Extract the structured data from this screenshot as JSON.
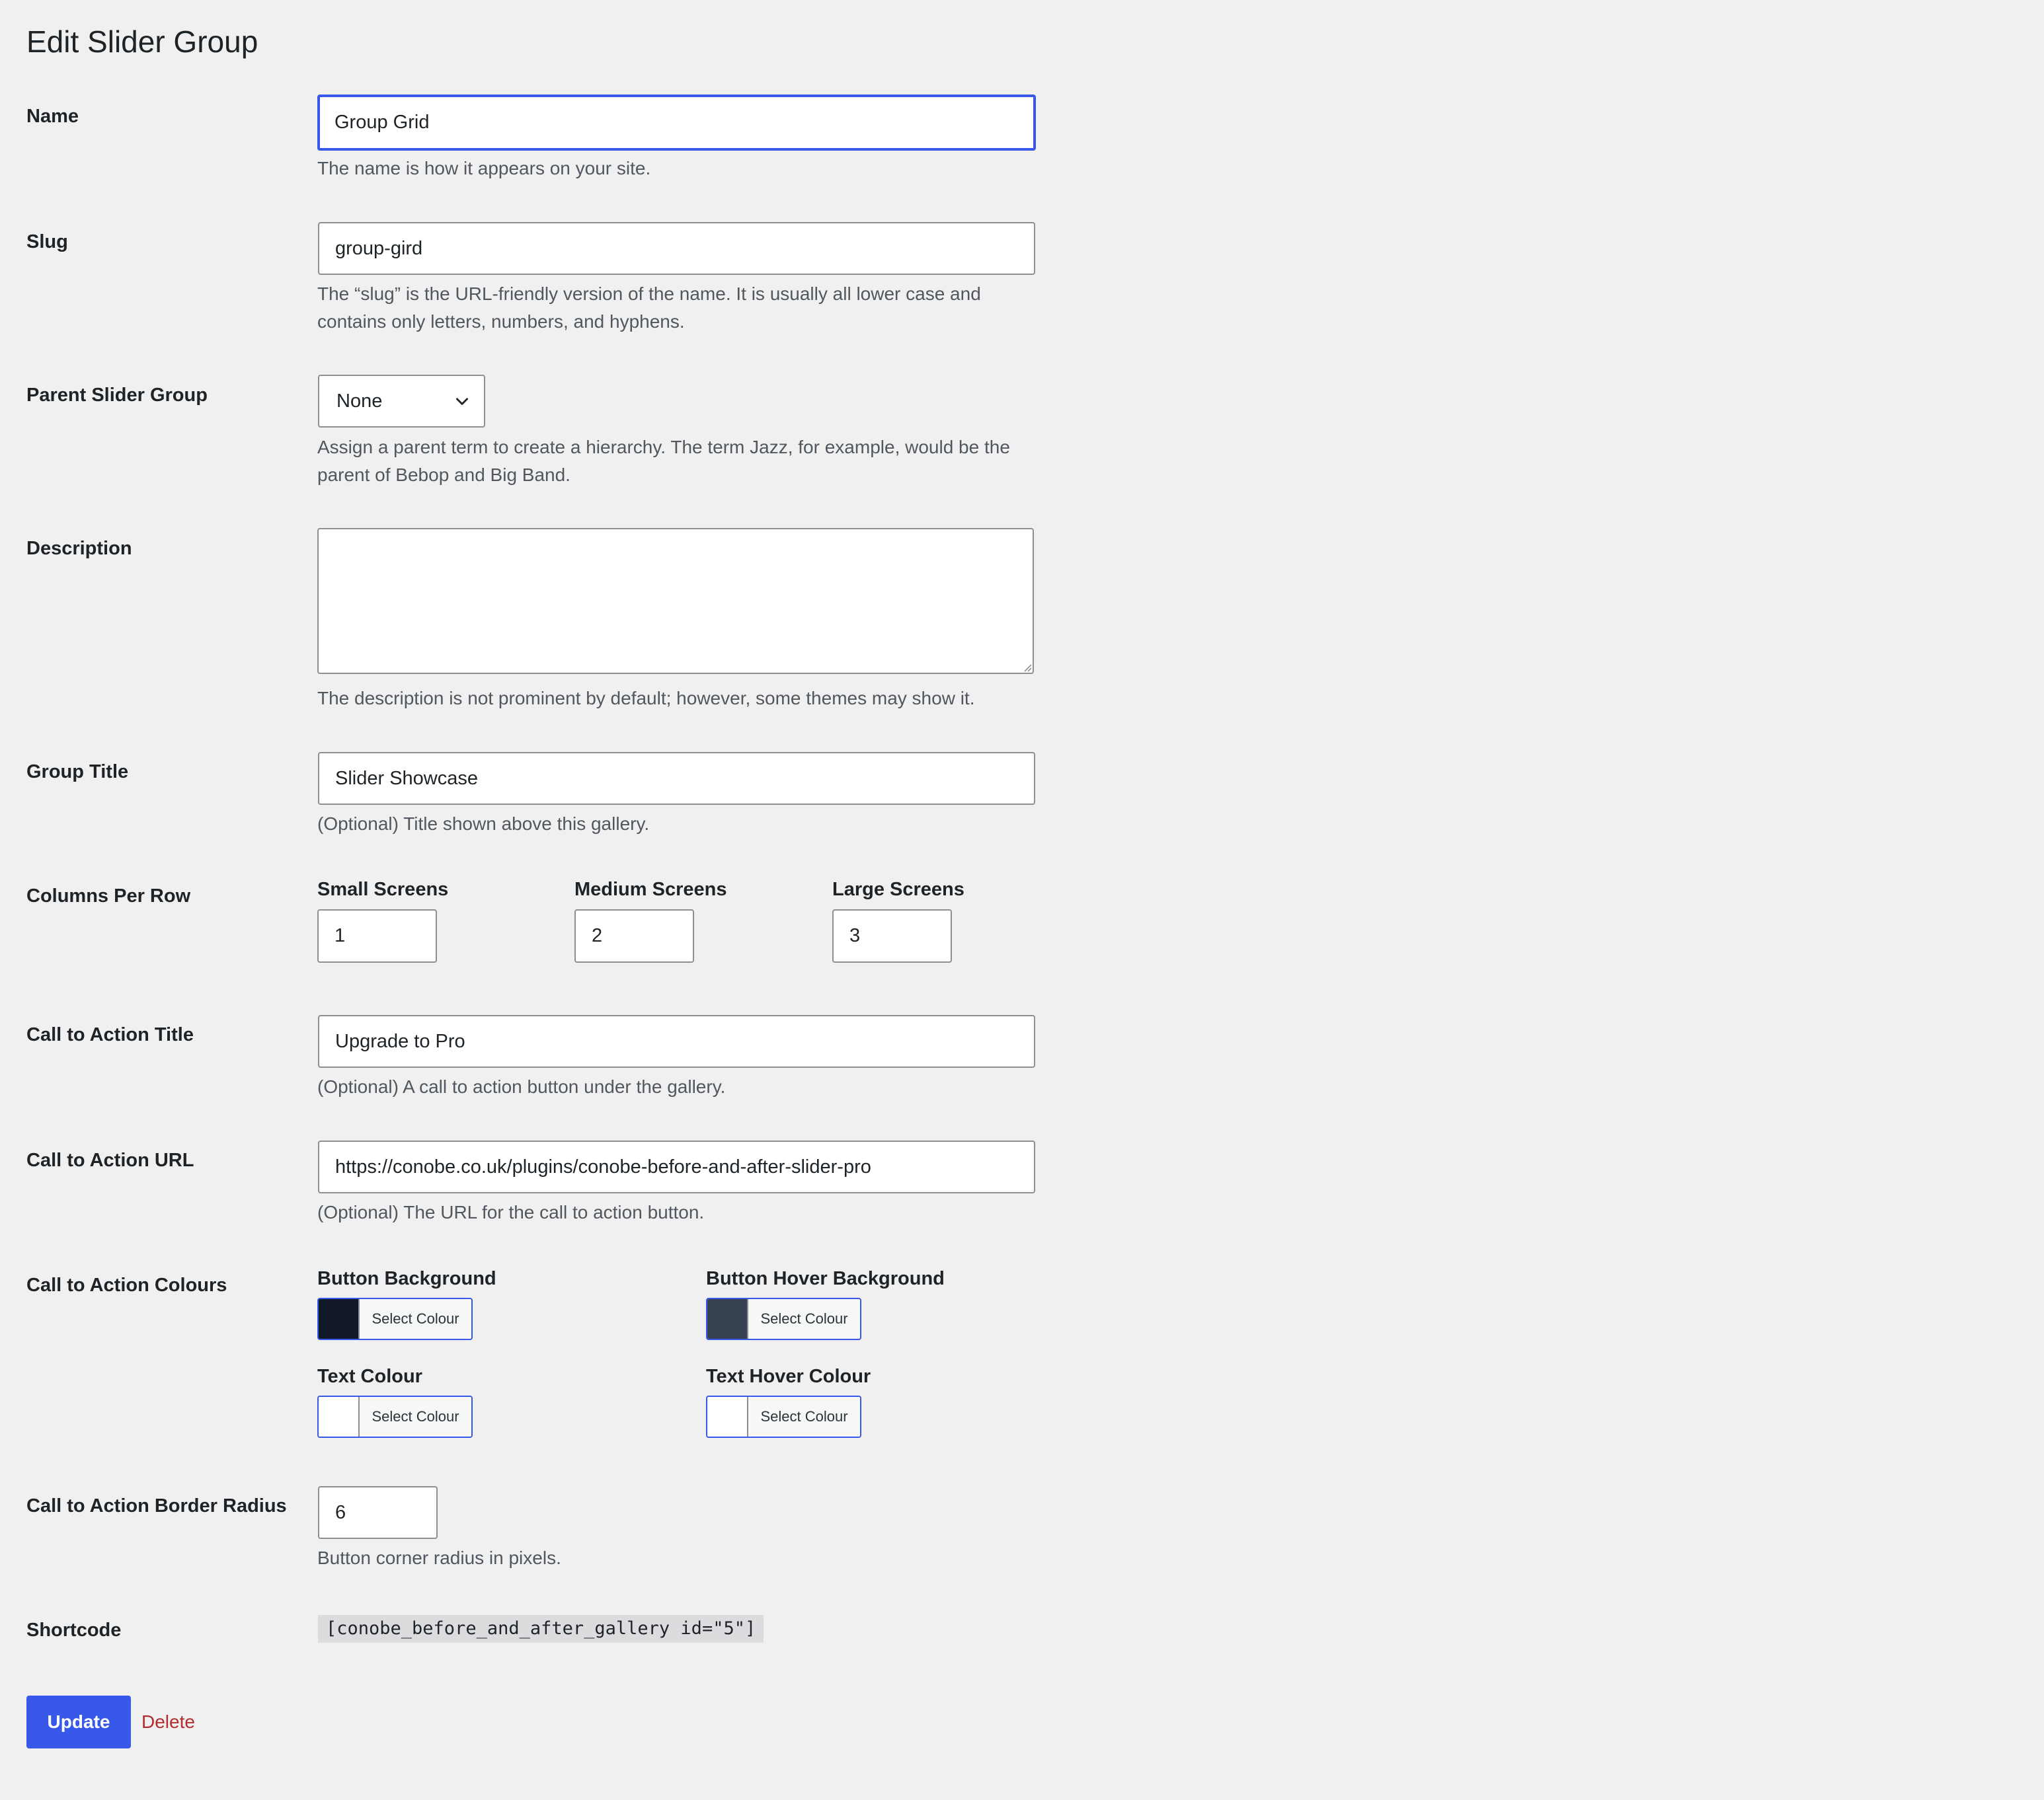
{
  "page": {
    "title": "Edit Slider Group"
  },
  "name": {
    "label": "Name",
    "value": "Group Grid",
    "description": "The name is how it appears on your site."
  },
  "slug": {
    "label": "Slug",
    "value": "group-gird",
    "description": "The “slug” is the URL-friendly version of the name. It is usually all lower case and contains only letters, numbers, and hyphens."
  },
  "parent": {
    "label": "Parent Slider Group",
    "selected": "None",
    "description": "Assign a parent term to create a hierarchy. The term Jazz, for example, would be the parent of Bebop and Big Band."
  },
  "description_field": {
    "label": "Description",
    "value": "",
    "description": "The description is not prominent by default; however, some themes may show it."
  },
  "group_title": {
    "label": "Group Title",
    "value": "Slider Showcase",
    "description": "(Optional) Title shown above this gallery."
  },
  "columns": {
    "label": "Columns Per Row",
    "small": {
      "label": "Small Screens",
      "value": "1"
    },
    "medium": {
      "label": "Medium Screens",
      "value": "2"
    },
    "large": {
      "label": "Large Screens",
      "value": "3"
    }
  },
  "cta_title": {
    "label": "Call to Action Title",
    "value": "Upgrade to Pro",
    "description": "(Optional) A call to action button under the gallery."
  },
  "cta_url": {
    "label": "Call to Action URL",
    "value": "https://conobe.co.uk/plugins/conobe-before-and-after-slider-pro",
    "description": "(Optional) The URL for the call to action button."
  },
  "cta_colours": {
    "label": "Call to Action Colours",
    "button_bg": {
      "label": "Button Background",
      "button": "Select Colour",
      "color": "#111827"
    },
    "button_hover_bg": {
      "label": "Button Hover Background",
      "button": "Select Colour",
      "color": "#374151"
    },
    "text": {
      "label": "Text Colour",
      "button": "Select Colour",
      "color": "#ffffff"
    },
    "text_hover": {
      "label": "Text Hover Colour",
      "button": "Select Colour",
      "color": "#ffffff"
    }
  },
  "cta_radius": {
    "label": "Call to Action Border Radius",
    "value": "6",
    "description": "Button corner radius in pixels."
  },
  "shortcode": {
    "label": "Shortcode",
    "value": "[conobe_before_and_after_gallery id=\"5\"]"
  },
  "actions": {
    "update": "Update",
    "delete": "Delete"
  },
  "theme": {
    "accent": "#3858e9",
    "danger": "#b32d2e",
    "background": "#f0f0f1"
  }
}
